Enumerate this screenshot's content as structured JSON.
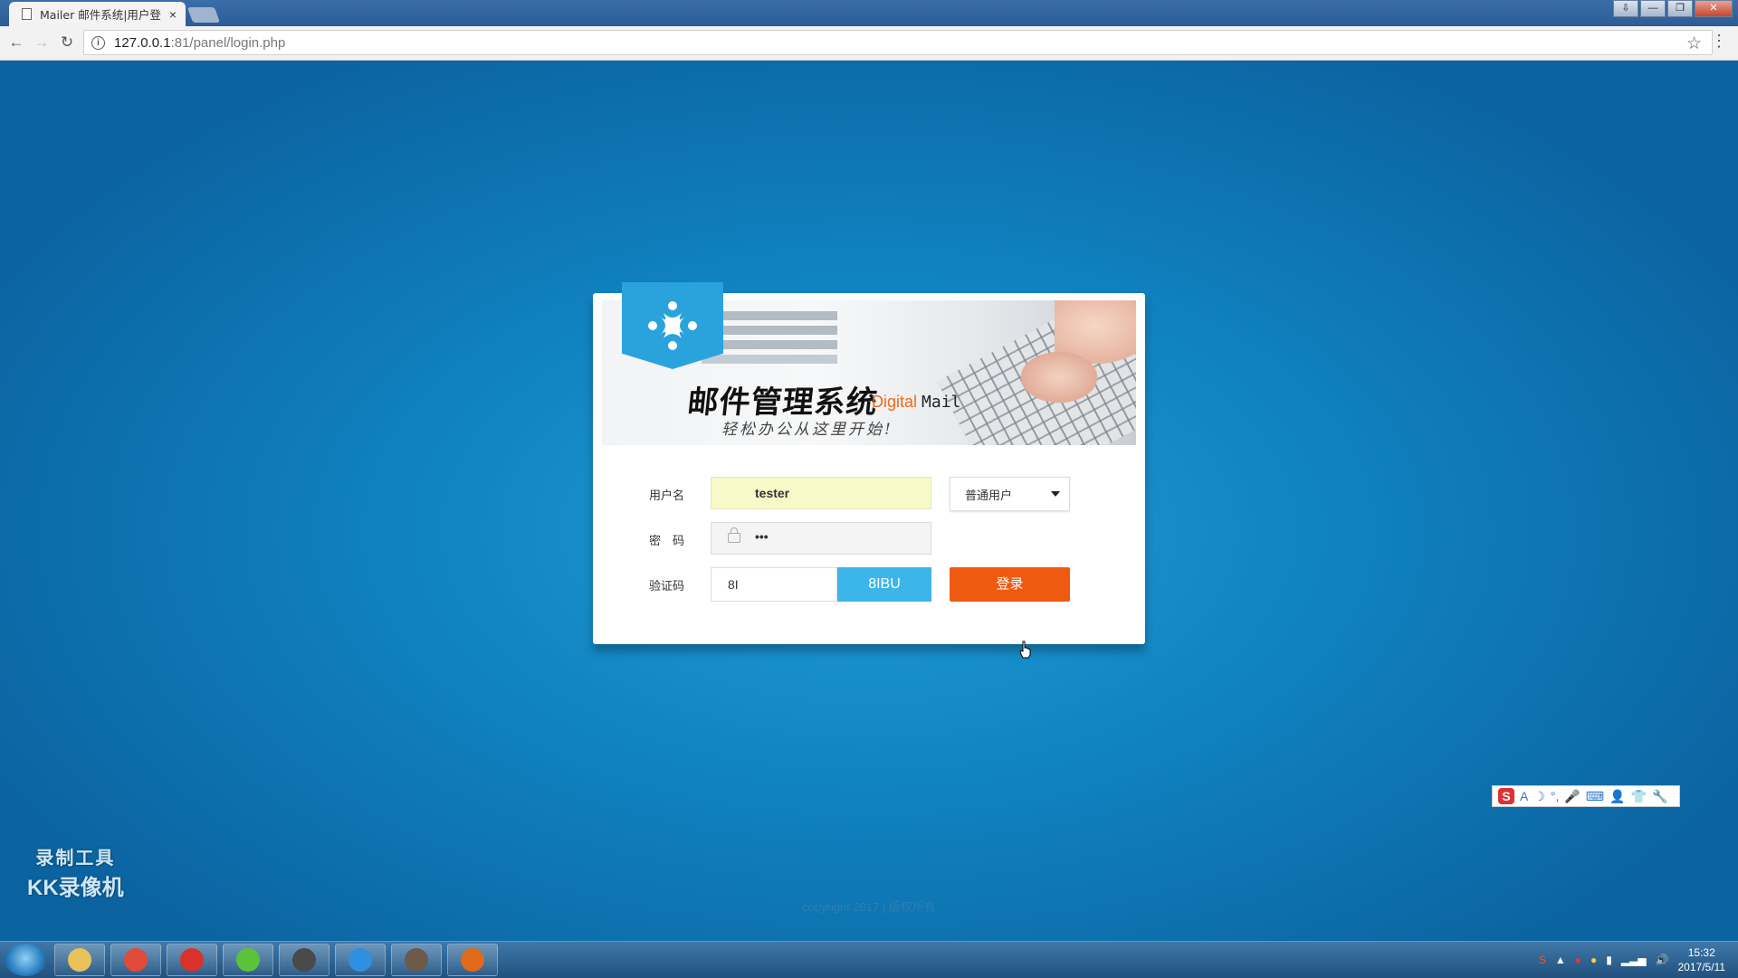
{
  "browser": {
    "tab_title": "Mailer 邮件系统|用户登",
    "tab_close": "×",
    "url_host": "127.0.0.1",
    "url_path": ":81/panel/login.php",
    "back": "←",
    "forward": "→",
    "reload": "↻",
    "star": "☆",
    "menu": "⋮",
    "info": "i"
  },
  "window_controls": [
    "⇩",
    "—",
    "❐",
    "✕"
  ],
  "banner": {
    "title_cn": "邮件管理系统",
    "title_en_digital": "Digital",
    "title_en_mail": "Mail",
    "slogan": "轻松办公从这里开始!"
  },
  "form": {
    "username_label": "用户名",
    "username_value": "tester",
    "password_label": "密　码",
    "password_value": "•••",
    "captcha_label": "验证码",
    "captcha_value": "8I",
    "captcha_image_text": "8IBU",
    "role_selected": "普通用户",
    "login_button": "登录"
  },
  "footer": {
    "copyright": "copyright 2017 | 版权所有"
  },
  "watermark": {
    "line1": "录制工具",
    "line2": "KK录像机"
  },
  "ime_bar": {
    "logo": "S",
    "items": [
      "A",
      "☽",
      "°,",
      "🎤",
      "⌨",
      "👤",
      "👕",
      "🔧"
    ]
  },
  "taskbar": {
    "apps": [
      {
        "name": "explorer-icon",
        "color": "#e8c25a"
      },
      {
        "name": "chrome-icon",
        "color": "#e04a3b"
      },
      {
        "name": "netease-music-icon",
        "color": "#d9312b"
      },
      {
        "name": "green-app-icon",
        "color": "#5cc23a"
      },
      {
        "name": "sublime-icon",
        "color": "#4a4a4a"
      },
      {
        "name": "wps-icon",
        "color": "#2f8fe0"
      },
      {
        "name": "avatar-app-icon",
        "color": "#6b5a4a"
      },
      {
        "name": "ninja-app-icon",
        "color": "#e06a1a"
      }
    ],
    "time": "15:32",
    "date": "2017/5/11"
  }
}
